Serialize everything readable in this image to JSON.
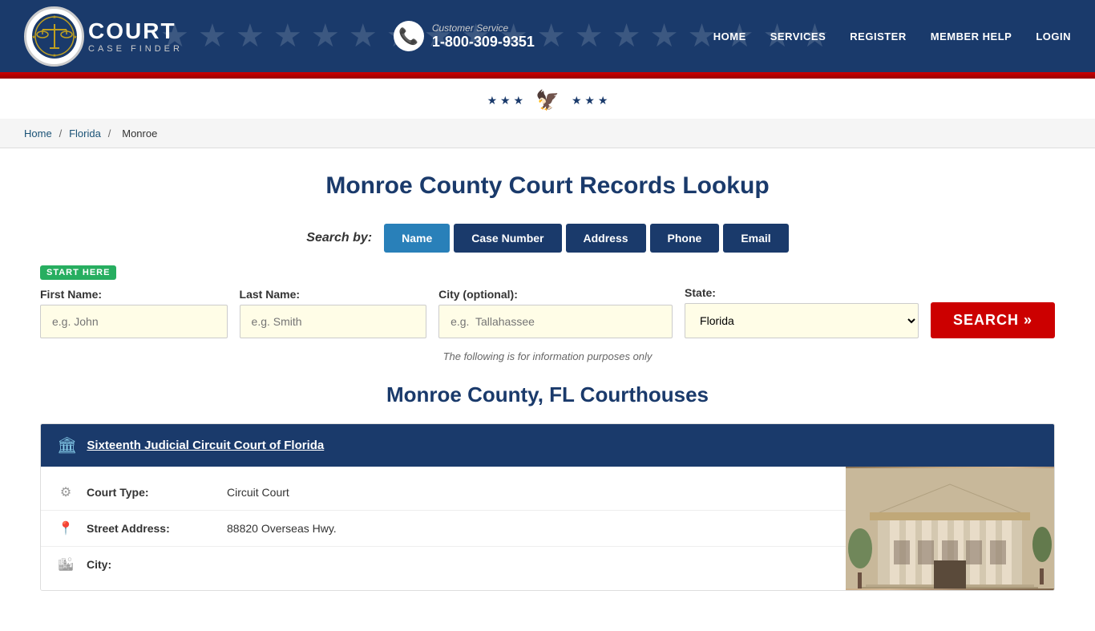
{
  "header": {
    "logo_court": "COURT",
    "logo_case_finder": "CASE FINDER",
    "cs_label": "Customer Service",
    "cs_number": "1-800-309-9351",
    "nav": [
      "HOME",
      "SERVICES",
      "REGISTER",
      "MEMBER HELP",
      "LOGIN"
    ]
  },
  "breadcrumb": {
    "home": "Home",
    "sep1": "/",
    "state": "Florida",
    "sep2": "/",
    "county": "Monroe"
  },
  "page": {
    "title": "Monroe County Court Records Lookup",
    "search_by_label": "Search by:",
    "tabs": [
      {
        "label": "Name",
        "active": true
      },
      {
        "label": "Case Number",
        "active": false
      },
      {
        "label": "Address",
        "active": false
      },
      {
        "label": "Phone",
        "active": false
      },
      {
        "label": "Email",
        "active": false
      }
    ],
    "start_here": "START HERE",
    "form": {
      "first_name_label": "First Name:",
      "first_name_placeholder": "e.g. John",
      "last_name_label": "Last Name:",
      "last_name_placeholder": "e.g. Smith",
      "city_label": "City (optional):",
      "city_placeholder": "e.g.  Tallahassee",
      "state_label": "State:",
      "state_value": "Florida",
      "search_btn": "SEARCH »"
    },
    "info_note": "The following is for information purposes only",
    "courthouses_title": "Monroe County, FL Courthouses",
    "courthouse": {
      "name": "Sixteenth Judicial Circuit Court of Florida",
      "court_type_label": "Court Type:",
      "court_type_value": "Circuit Court",
      "address_label": "Street Address:",
      "address_value": "88820 Overseas Hwy.",
      "city_label": "City:"
    }
  }
}
